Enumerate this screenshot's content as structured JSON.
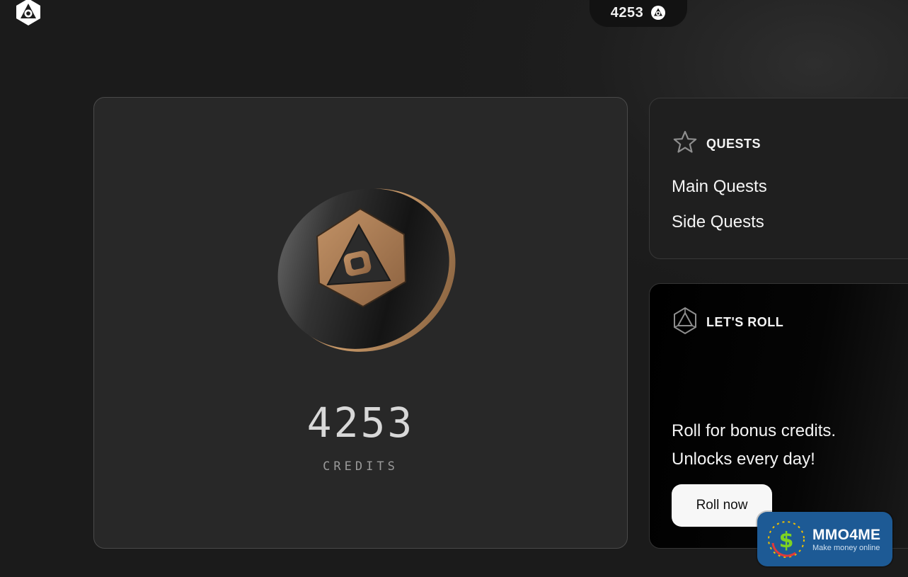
{
  "header": {
    "logo_icon": "hex-triangle-logo-icon",
    "credits_pill_value": "4253",
    "credits_pill_icon": "coin-icon"
  },
  "credits_card": {
    "value": "4253",
    "label": "CREDITS",
    "coin_colors": {
      "body": "#1b1b1b",
      "rim": "#b08050",
      "emblem": "#a8774b"
    }
  },
  "quests_card": {
    "title": "QUESTS",
    "icon": "star-icon",
    "links": [
      "Main Quests",
      "Side Quests"
    ]
  },
  "roll_card": {
    "title": "LET'S ROLL",
    "icon": "d20-dice-icon",
    "line1": "Roll for bonus credits.",
    "line2": "Unlocks every day!",
    "button_label": "Roll now"
  },
  "watermark": {
    "title": "MMO4ME",
    "subtitle": "Make money online",
    "icon": "dollar-globe-icon",
    "color": "#1d5a95"
  }
}
